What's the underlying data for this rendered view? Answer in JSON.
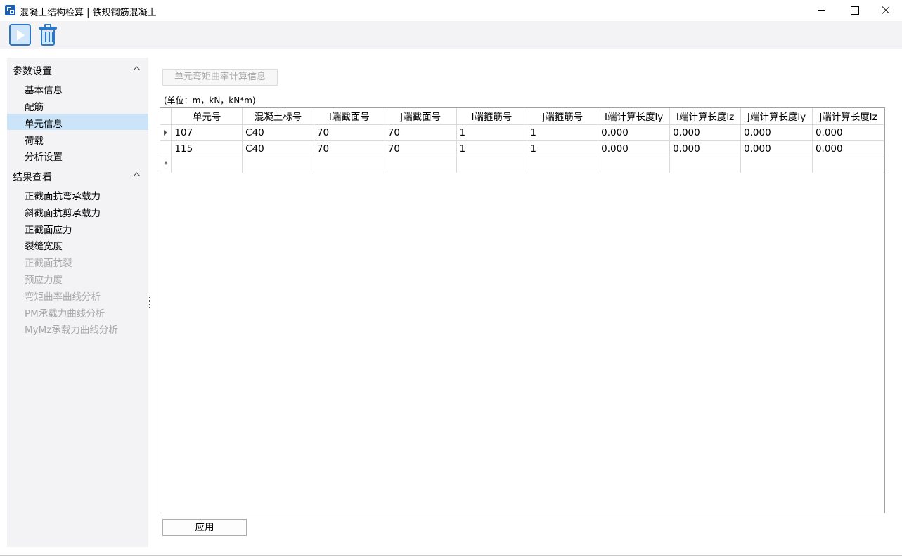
{
  "window": {
    "title": "混凝土结构检算 | 铁规钢筋混凝土"
  },
  "toolbar": {
    "run_icon": "play-icon",
    "delete_icon": "trash-icon"
  },
  "sidebar": {
    "groups": [
      {
        "label": "参数设置",
        "items": [
          {
            "label": "基本信息",
            "state": "normal"
          },
          {
            "label": "配筋",
            "state": "normal"
          },
          {
            "label": "单元信息",
            "state": "selected"
          },
          {
            "label": "荷载",
            "state": "normal"
          },
          {
            "label": "分析设置",
            "state": "normal"
          }
        ]
      },
      {
        "label": "结果查看",
        "items": [
          {
            "label": "正截面抗弯承载力",
            "state": "normal"
          },
          {
            "label": "斜截面抗剪承载力",
            "state": "normal"
          },
          {
            "label": "正截面应力",
            "state": "normal"
          },
          {
            "label": "裂缝宽度",
            "state": "normal"
          },
          {
            "label": "正截面抗裂",
            "state": "disabled"
          },
          {
            "label": "预应力度",
            "state": "disabled"
          },
          {
            "label": "弯矩曲率曲线分析",
            "state": "disabled"
          },
          {
            "label": "PM承载力曲线分析",
            "state": "disabled"
          },
          {
            "label": "MyMz承载力曲线分析",
            "state": "disabled"
          }
        ]
      }
    ]
  },
  "main": {
    "tab_label": "单元弯矩曲率计算信息",
    "units_text": "(单位：m，kN，kN*m)",
    "table": {
      "columns": [
        "单元号",
        "混凝土标号",
        "I端截面号",
        "J端截面号",
        "I端箍筋号",
        "J端箍筋号",
        "I端计算长度ly",
        "I端计算长度lz",
        "J端计算长度ly",
        "J端计算长度lz"
      ],
      "rows": [
        [
          "107",
          "C40",
          "70",
          "70",
          "1",
          "1",
          "0.000",
          "0.000",
          "0.000",
          "0.000"
        ],
        [
          "115",
          "C40",
          "70",
          "70",
          "1",
          "1",
          "0.000",
          "0.000",
          "0.000",
          "0.000"
        ]
      ]
    },
    "apply_label": "应用"
  },
  "colors": {
    "selected_bg": "#cce4f7",
    "panel_bg": "#f3f2f5",
    "disabled_text": "#a8a8a8",
    "icon_blue": "#2c78c6"
  }
}
